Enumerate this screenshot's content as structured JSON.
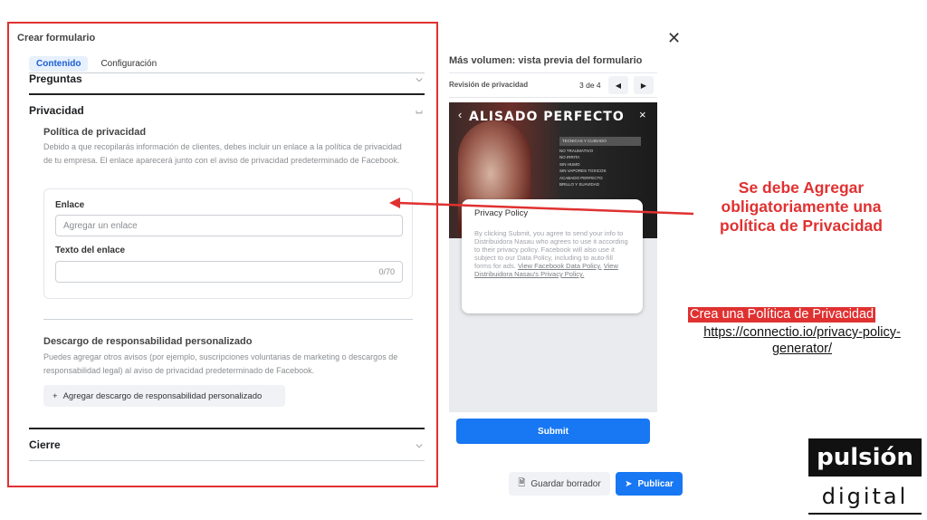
{
  "form": {
    "title": "Crear formulario",
    "tabs": [
      {
        "label": "Contenido",
        "active": true
      },
      {
        "label": "Configuración",
        "active": false
      }
    ],
    "sections": {
      "preguntas": "Preguntas",
      "privacidad": "Privacidad",
      "cierre": "Cierre"
    },
    "privacy": {
      "title": "Política de privacidad",
      "description": "Debido a que recopilarás información de clientes, debes incluir un enlace a la política de privacidad de tu empresa. El enlace aparecerá junto con el aviso de privacidad predeterminado de Facebook.",
      "link_label": "Enlace",
      "link_placeholder": "Agregar un enlace",
      "link_text_label": "Texto del enlace",
      "link_text_counter": "0/70"
    },
    "disclaimer": {
      "title": "Descargo de responsabilidad personalizado",
      "description": "Puedes agregar otros avisos (por ejemplo, suscripciones voluntarias de marketing o descargos de responsabilidad legal) al aviso de privacidad predeterminado de Facebook.",
      "add_button": "Agregar descargo de responsabilidad personalizado"
    }
  },
  "preview": {
    "title": "Más volumen: vista previa del formulario",
    "step_label": "Revisión de privacidad",
    "page": "3 de 4",
    "hero_brand": "ALISADO PERFECTO",
    "hero_list": [
      "TECNICAS Y CUIDADO",
      "NO TRAUMATIVO",
      "NO IRRITA",
      "SIN HUMO",
      "SIN VAPORES TOXICOS",
      "ACABADO PERFECTO",
      "BRILLO Y SUAVIDAD"
    ],
    "policy_title": "Privacy Policy",
    "policy_text": "By clicking Submit, you agree to send your info to Distribuidora Nasau who agrees to use it according to their privacy policy. Facebook will also use it subject to our Data Policy, including to auto-fill forms for ads.",
    "policy_link1": "View Facebook Data Policy.",
    "policy_link2": "View Distribuidora Nasau's Privacy Policy.",
    "submit": "Submit"
  },
  "footer": {
    "draft": "Guardar borrador",
    "publish": "Publicar"
  },
  "annotation": {
    "line1": "Se debe Agregar",
    "line2": "obligatoriamente  una",
    "line3": "política de Privacidad",
    "crea": "Crea una Política de Privacidad",
    "url": "https://connectio.io/privacy-policy-generator/",
    "color": "#e03131"
  },
  "logo": {
    "top": "pulsión",
    "bottom": "digital"
  }
}
